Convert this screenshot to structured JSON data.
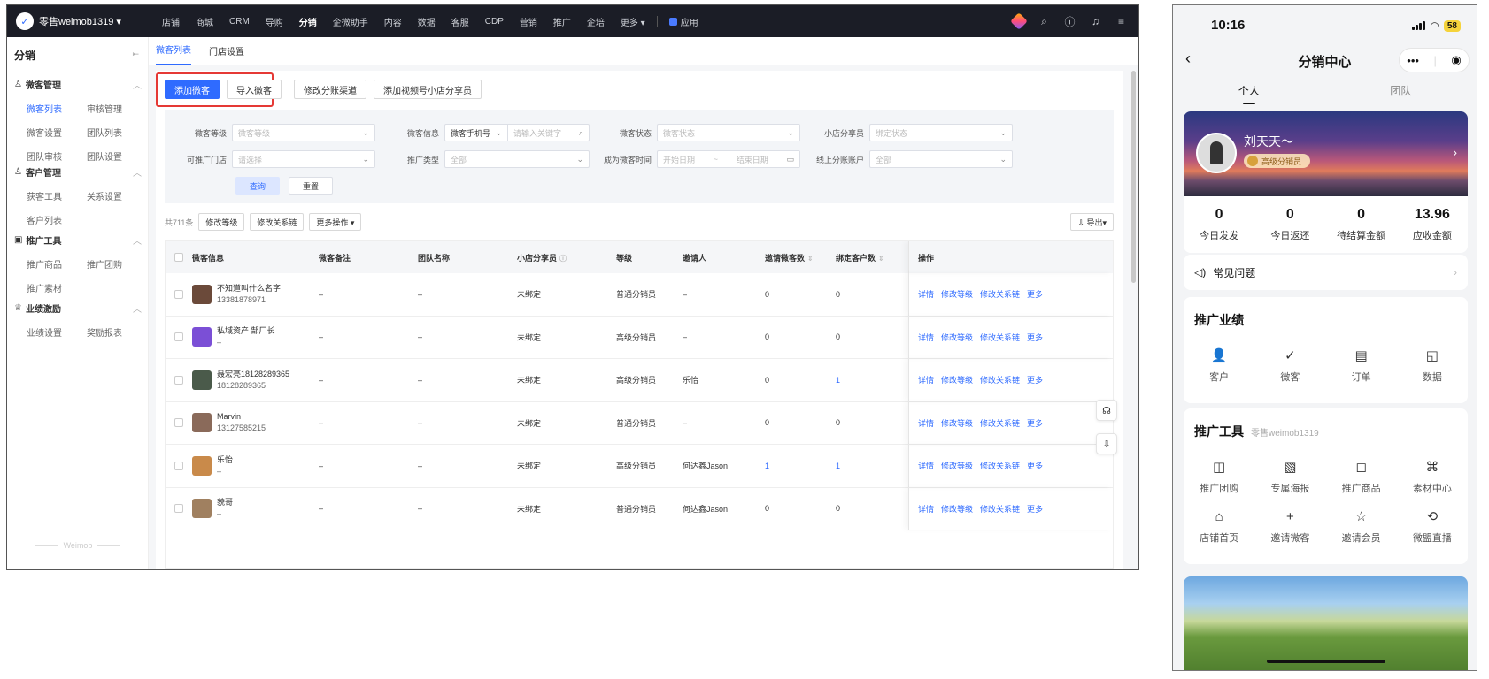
{
  "desktop": {
    "brand": "零售weimob1319 ▾",
    "menu": [
      "店铺",
      "商城",
      "CRM",
      "导购",
      "分销",
      "企微助手",
      "内容",
      "数据",
      "客服",
      "CDP",
      "营销",
      "推广",
      "企培",
      "更多 ▾"
    ],
    "menu_active": "分销",
    "apps_label": "应用",
    "sidebar": {
      "title": "分销",
      "collapse": "⇤",
      "groups": [
        {
          "title": "微客管理",
          "items": [
            "微客列表",
            "审核管理",
            "微客设置",
            "团队列表",
            "团队审核",
            "团队设置"
          ],
          "active": "微客列表"
        },
        {
          "title": "客户管理",
          "items": [
            "获客工具",
            "关系设置",
            "客户列表"
          ]
        },
        {
          "title": "推广工具",
          "items": [
            "推广商品",
            "推广团购",
            "推广素材"
          ]
        },
        {
          "title": "业绩激励",
          "items": [
            "业绩设置",
            "奖励报表"
          ]
        }
      ],
      "watermark": "Weimob"
    },
    "tabs": [
      "微客列表",
      "门店设置"
    ],
    "actions": {
      "add": "添加微客",
      "import": "导入微客",
      "channel": "修改分账渠道",
      "video": "添加视频号小店分享员"
    },
    "filters": {
      "level_label": "微客等级",
      "level_ph": "微客等级",
      "info_label": "微客信息",
      "info_select": "微客手机号",
      "info_ph": "请输入关键字",
      "status_label": "微客状态",
      "status_ph": "微客状态",
      "sharer_label": "小店分享员",
      "sharer_ph": "绑定状态",
      "store_label": "可推广门店",
      "store_ph": "请选择",
      "type_label": "推广类型",
      "type_val": "全部",
      "time_label": "成为微客时间",
      "time_start": "开始日期",
      "time_sep": "~",
      "time_end": "结束日期",
      "account_label": "线上分账账户",
      "account_val": "全部",
      "query": "查询",
      "reset": "重置"
    },
    "toolbar": {
      "total": "共711条",
      "edit_level": "修改等级",
      "edit_relation": "修改关系链",
      "more": "更多操作 ▾",
      "export": "⇩ 导出▾"
    },
    "columns": [
      "微客信息",
      "微客备注",
      "团队名称",
      "小店分享员",
      "等级",
      "邀请人",
      "邀请微客数",
      "绑定客户数",
      "操作"
    ],
    "rows": [
      {
        "name": "不知道叫什么名字",
        "phone": "13381878971",
        "note": "–",
        "team": "–",
        "shop": "未绑定",
        "level": "普通分销员",
        "inviter": "–",
        "invited": "0",
        "bound": "0",
        "avatar": "#6b4a3a"
      },
      {
        "name": "私域资产 郜厂长",
        "phone": "–",
        "note": "–",
        "team": "–",
        "shop": "未绑定",
        "level": "高级分销员",
        "inviter": "–",
        "invited": "0",
        "bound": "0",
        "avatar": "#7b4fd6"
      },
      {
        "name": "聂宏亮18128289365",
        "phone": "18128289365",
        "note": "–",
        "team": "–",
        "shop": "未绑定",
        "level": "高级分销员",
        "inviter": "乐怡",
        "invited": "0",
        "bound": "1",
        "avatar": "#4a5a4a"
      },
      {
        "name": "Marvin",
        "phone": "13127585215",
        "note": "–",
        "team": "–",
        "shop": "未绑定",
        "level": "普通分销员",
        "inviter": "–",
        "invited": "0",
        "bound": "0",
        "avatar": "#8a6a5a"
      },
      {
        "name": "乐怡",
        "phone": "–",
        "note": "–",
        "team": "–",
        "shop": "未绑定",
        "level": "高级分销员",
        "inviter": "何达鑫Jason",
        "invited": "1",
        "bound": "1",
        "avatar": "#c98a4a"
      },
      {
        "name": "貌哥",
        "phone": "–",
        "note": "–",
        "team": "–",
        "shop": "未绑定",
        "level": "普通分销员",
        "inviter": "何达鑫Jason",
        "invited": "0",
        "bound": "0",
        "avatar": "#a08060"
      }
    ],
    "row_ops": [
      "详情",
      "修改等级",
      "修改关系链",
      "更多"
    ]
  },
  "phone": {
    "time": "10:16",
    "battery": "58",
    "title": "分销中心",
    "tabs": [
      "个人",
      "团队"
    ],
    "user_name": "刘天天～",
    "user_level": "高级分销员",
    "stats": [
      {
        "value": "0",
        "label": "今日发发"
      },
      {
        "value": "0",
        "label": "今日返还"
      },
      {
        "value": "0",
        "label": "待结算金额"
      },
      {
        "value": "13.96",
        "label": "应收金额"
      }
    ],
    "faq": "常见问题",
    "perf_title": "推广业绩",
    "perf_items": [
      {
        "icon": "👤",
        "label": "客户"
      },
      {
        "icon": "✓",
        "label": "微客"
      },
      {
        "icon": "▤",
        "label": "订单"
      },
      {
        "icon": "◱",
        "label": "数据"
      }
    ],
    "tools_title": "推广工具",
    "tools_sub": "零售weimob1319",
    "tool_items": [
      {
        "icon": "◫",
        "label": "推广团购"
      },
      {
        "icon": "▧",
        "label": "专属海报"
      },
      {
        "icon": "◻",
        "label": "推广商品"
      },
      {
        "icon": "⌘",
        "label": "素材中心"
      },
      {
        "icon": "⌂",
        "label": "店铺首页"
      },
      {
        "icon": "+",
        "label": "邀请微客"
      },
      {
        "icon": "☆",
        "label": "邀请会员"
      },
      {
        "icon": "⟲",
        "label": "微盟直播"
      }
    ]
  }
}
